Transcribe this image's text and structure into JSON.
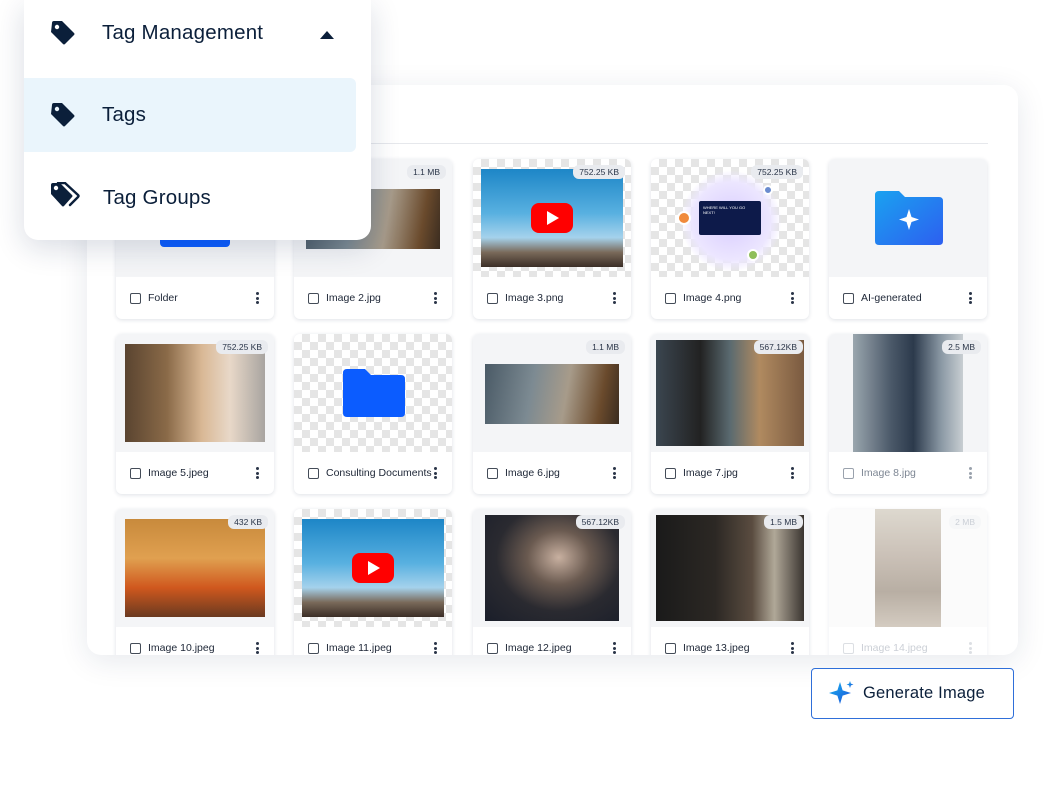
{
  "menu": {
    "header_label": "Tag Management",
    "items": [
      {
        "label": "Tags"
      },
      {
        "label": "Tag Groups"
      }
    ]
  },
  "assets": [
    {
      "name": "Folder",
      "size": ""
    },
    {
      "name": "Image 2.jpg",
      "size": "1.1 MB"
    },
    {
      "name": "Image 3.png",
      "size": "752.25 KB"
    },
    {
      "name": "Image 4.png",
      "size": "752.25 KB"
    },
    {
      "name": "AI-generated",
      "size": ""
    },
    {
      "name": "Image 5.jpeg",
      "size": "752.25 KB"
    },
    {
      "name": "Consulting Documents",
      "size": ""
    },
    {
      "name": "Image 6.jpg",
      "size": "1.1 MB"
    },
    {
      "name": "Image 7.jpg",
      "size": "567.12KB"
    },
    {
      "name": "Image 8.jpg",
      "size": "2.5 MB"
    },
    {
      "name": "Image 10.jpeg",
      "size": "432 KB"
    },
    {
      "name": "Image 11.jpeg",
      "size": ""
    },
    {
      "name": "Image 12.jpeg",
      "size": "567.12KB"
    },
    {
      "name": "Image 13.jpeg",
      "size": "1.5 MB"
    },
    {
      "name": "Image 14.jpeg",
      "size": "2 MB"
    }
  ],
  "promo_text": "WHERE WILL YOU GO NEXT!",
  "generate_button": {
    "label": "Generate Image"
  },
  "colors": {
    "accent": "#0b5cff",
    "menu_active_bg": "#eaf5fc",
    "text_dark": "#0b1f3a",
    "youtube_red": "#ff0000"
  },
  "icons": {
    "menu_header": "tag-icon",
    "tags": "tag-icon",
    "tag_groups": "tags-icon",
    "header_chevron": "chevron-up-icon",
    "generate": "sparkle-icon",
    "card_menu": "kebab-icon",
    "video": "play-icon"
  }
}
